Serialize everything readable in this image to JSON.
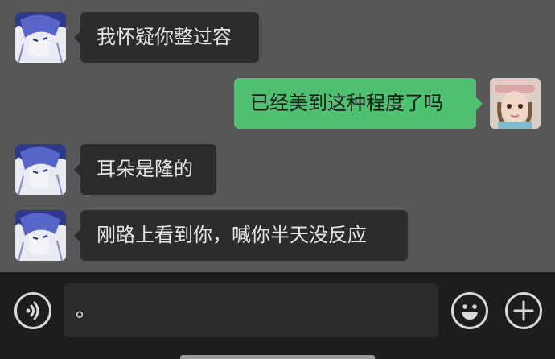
{
  "messages": [
    {
      "side": "left",
      "text": "我怀疑你整过容"
    },
    {
      "side": "right",
      "text": "已经美到这种程度了吗"
    },
    {
      "side": "left",
      "text": "耳朵是隆的"
    },
    {
      "side": "left",
      "text": "刚路上看到你，喊你半天没反应"
    }
  ],
  "input": {
    "value": "。"
  },
  "icons": {
    "voice": "voice-icon",
    "emoji": "emoji-icon",
    "more": "plus-icon"
  },
  "colors": {
    "chat_background": "#575757",
    "incoming_bubble": "#2c2c2c",
    "outgoing_bubble": "#4ec06f",
    "input_bar": "#1d1d1d"
  }
}
